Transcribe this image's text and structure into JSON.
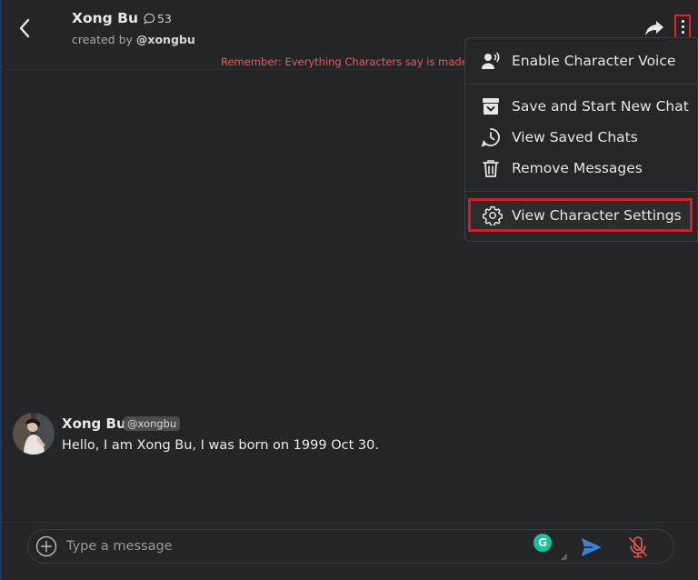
{
  "header": {
    "character_name": "Xong Bu",
    "chat_count": "53",
    "created_by_prefix": "created by",
    "creator_handle": "@xongbu",
    "disclaimer": "Remember: Everything Characters say is made"
  },
  "menu": {
    "items": [
      {
        "label": "Enable Character Voice",
        "icon": "voice-icon"
      },
      {
        "label": "Save and Start New Chat",
        "icon": "archive-icon"
      },
      {
        "label": "View Saved Chats",
        "icon": "history-icon"
      },
      {
        "label": "Remove Messages",
        "icon": "trash-icon"
      },
      {
        "label": "View Character Settings",
        "icon": "gear-icon"
      }
    ],
    "highlighted_item": "View Character Settings"
  },
  "message": {
    "author": "Xong Bu",
    "handle": "@xongbu",
    "text": "Hello, I am Xong Bu, I was born on 1999 Oct 30."
  },
  "composer": {
    "placeholder": "Type a message",
    "grammarly_letter": "G"
  },
  "colors": {
    "background": "#242526",
    "highlight_border": "#d21f2a",
    "disclaimer": "#e65f5f",
    "send_icon": "#3b82d6",
    "mic_muted": "#d9534f",
    "grammarly": "#15c39a"
  }
}
